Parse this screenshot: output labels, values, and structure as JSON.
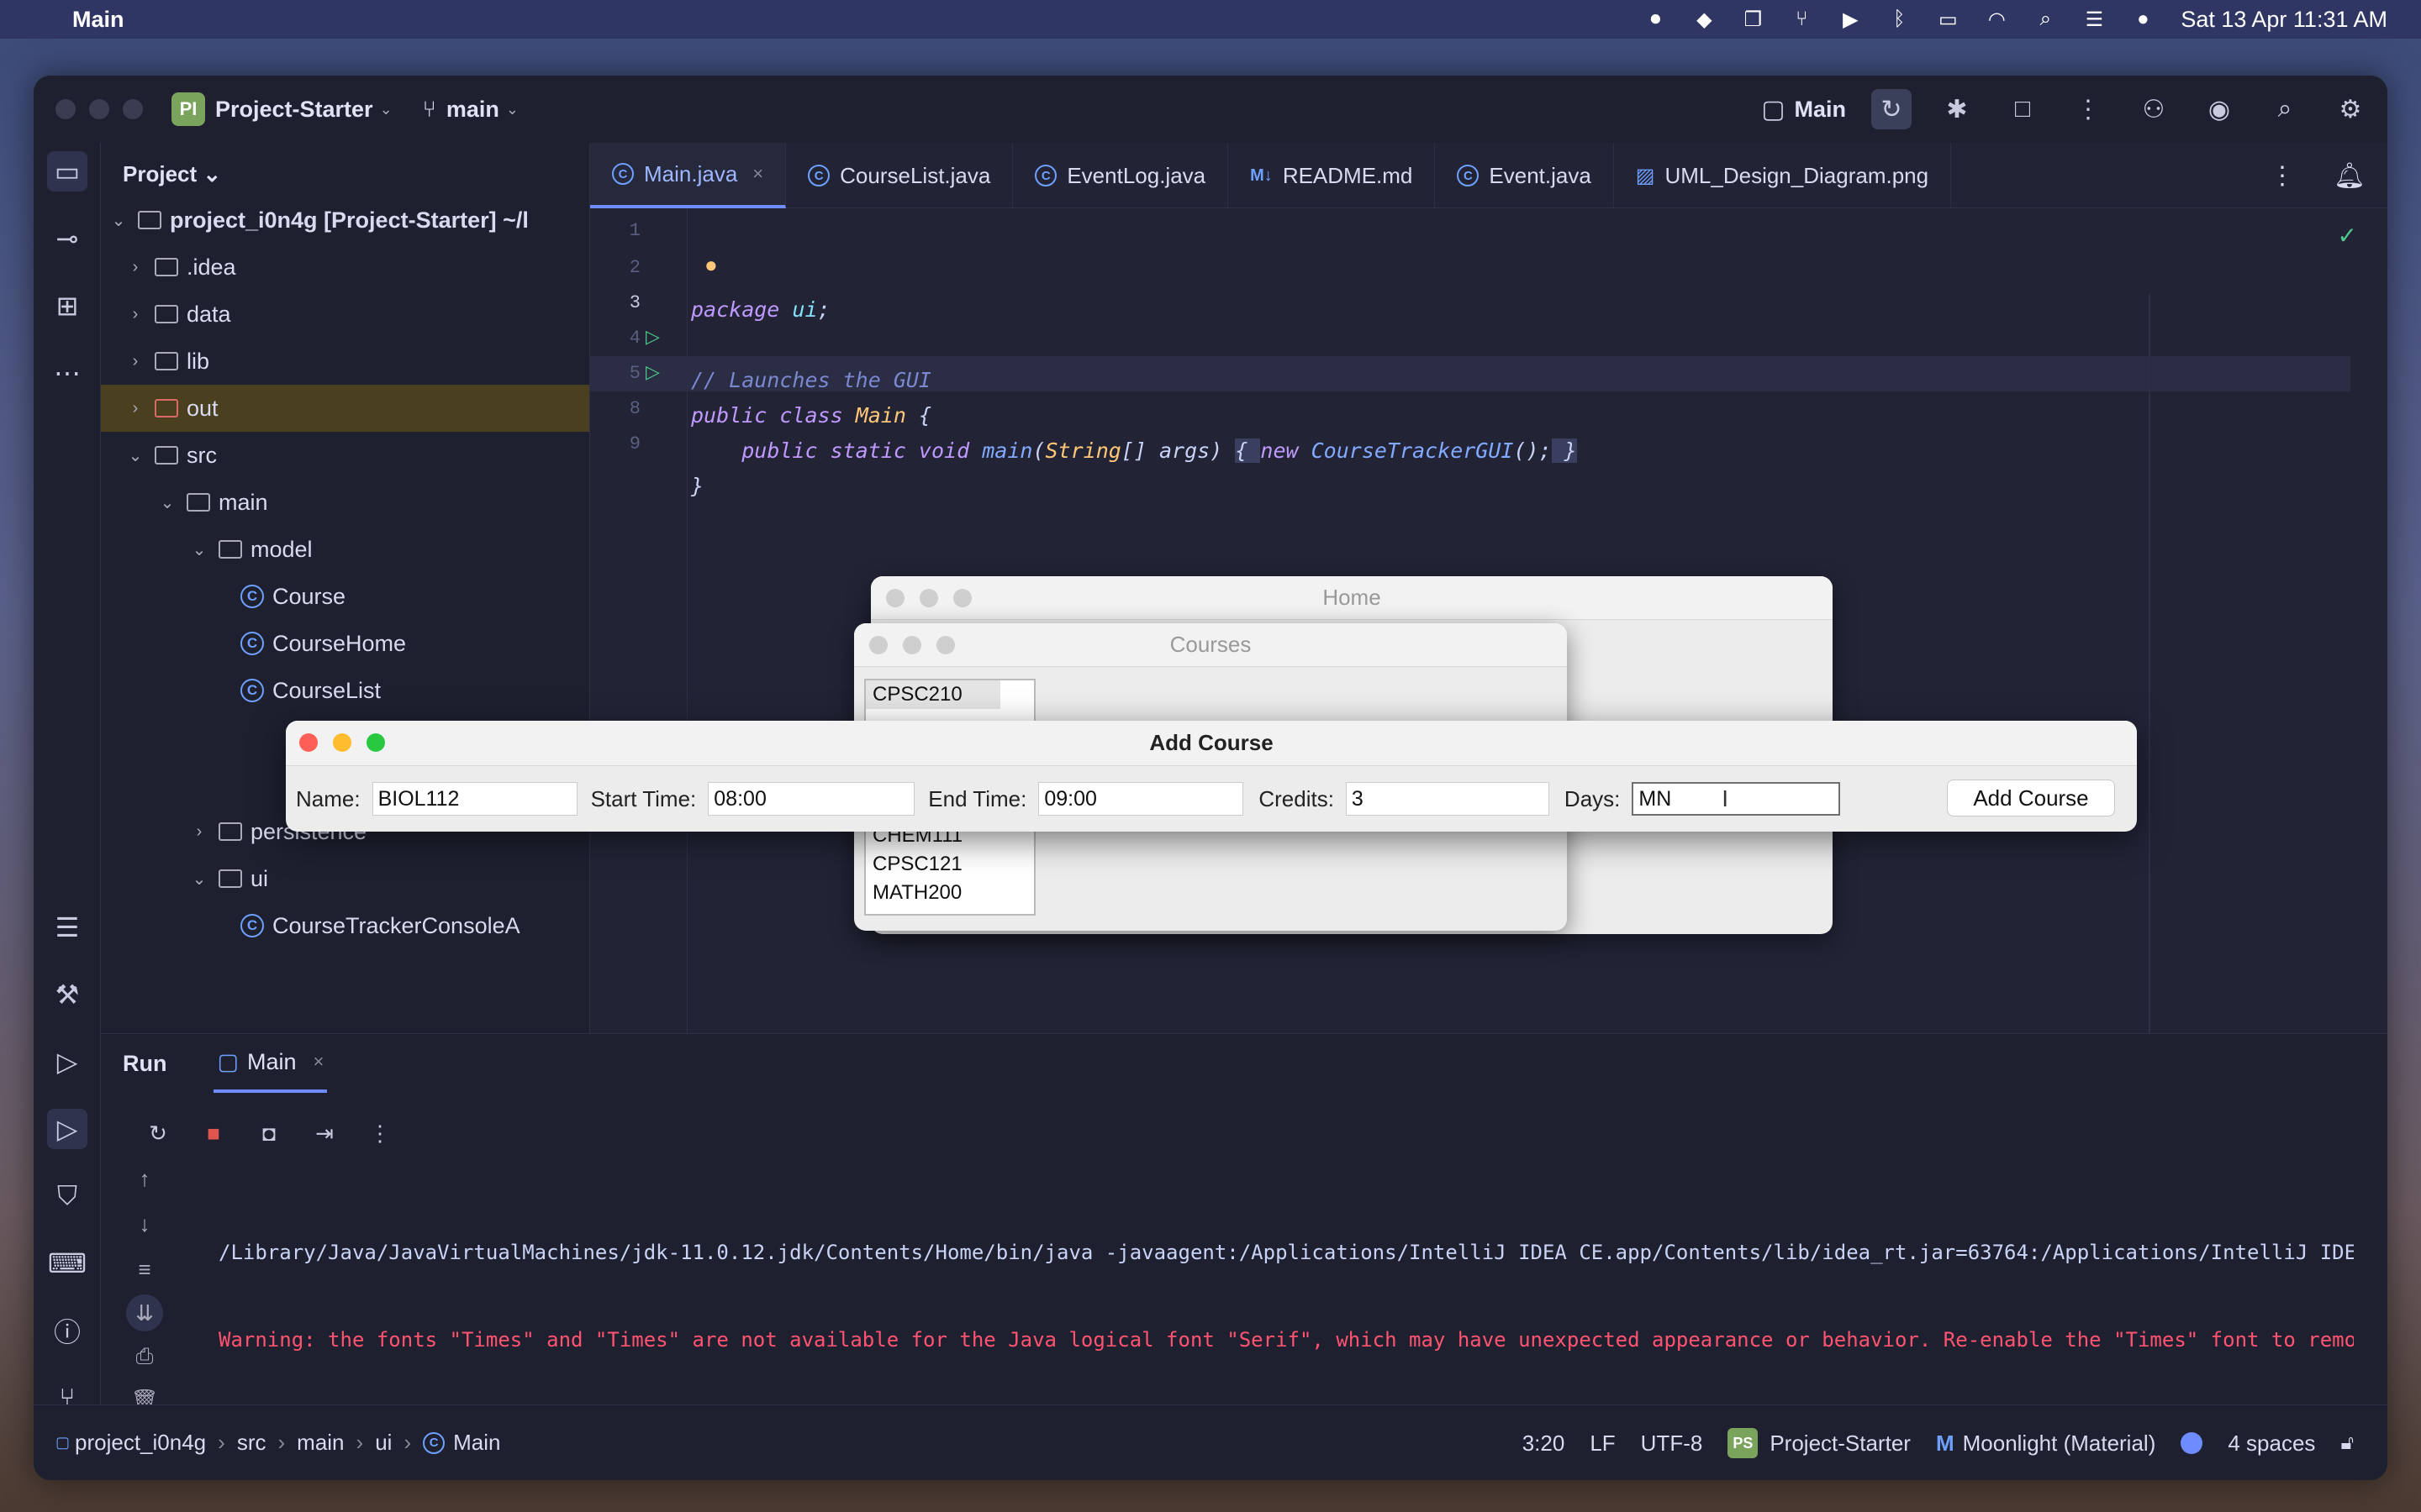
{
  "menubar": {
    "app_name": "Main",
    "datetime": "Sat 13 Apr  11:31 AM"
  },
  "titlebar": {
    "project_badge": "PI",
    "project_name": "Project-Starter",
    "branch": "main",
    "run_config": "Main"
  },
  "project_panel": {
    "title": "Project",
    "tree": [
      {
        "label": "project_i0n4g [Project-Starter] ~/l"
      },
      {
        "label": ".idea"
      },
      {
        "label": "data"
      },
      {
        "label": "lib"
      },
      {
        "label": "out"
      },
      {
        "label": "src"
      },
      {
        "label": "main"
      },
      {
        "label": "model"
      },
      {
        "label": "Course"
      },
      {
        "label": "CourseHome"
      },
      {
        "label": "CourseList"
      },
      {
        "label": "persistence"
      },
      {
        "label": "ui"
      },
      {
        "label": "CourseTrackerConsoleA"
      }
    ]
  },
  "editor": {
    "tabs": [
      {
        "label": "Main.java",
        "icon": "C"
      },
      {
        "label": "CourseList.java",
        "icon": "C"
      },
      {
        "label": "EventLog.java",
        "icon": "C"
      },
      {
        "label": "README.md",
        "icon": "M↓"
      },
      {
        "label": "Event.java",
        "icon": "C"
      },
      {
        "label": "UML_Design_Diagram.png",
        "icon": "img"
      }
    ],
    "line_numbers": [
      "1",
      "2",
      "3",
      "4",
      "5",
      "8",
      "9"
    ],
    "code": {
      "l1_kw": "package",
      "l1_pk": "ui",
      "l3_comment": "// Launches the GUI",
      "l4_kw": "public class",
      "l4_cn": "Main",
      "l5_kw": "public static void",
      "l5_fn": "main",
      "l5_type": "String",
      "l5_args": "args",
      "l5_new": "new",
      "l5_call": "CourseTrackerGUI"
    }
  },
  "home_window": {
    "title": "Home"
  },
  "courses_window": {
    "title": "Courses",
    "top_list": [
      "CPSC210"
    ],
    "bottom_list": [
      "CHEM111",
      "CPSC121",
      "MATH200"
    ]
  },
  "add_course": {
    "title": "Add Course",
    "name_label": "Name:",
    "name_value": "BIOL112",
    "start_label": "Start Time:",
    "start_value": "08:00",
    "end_label": "End Time:",
    "end_value": "09:00",
    "credits_label": "Credits:",
    "credits_value": "3",
    "days_label": "Days:",
    "days_value": "MN",
    "button": "Add Course"
  },
  "run_panel": {
    "run_label": "Run",
    "tab_label": "Main",
    "console": [
      {
        "text": "/Library/Java/JavaVirtualMachines/jdk-11.0.12.jdk/Contents/Home/bin/java -javaagent:/Applications/IntelliJ IDEA CE.app/Contents/lib/idea_rt.jar=63764:/Applications/IntelliJ IDE",
        "color": "#c8d3f5"
      },
      {
        "text": "Warning: the fonts \"Times\" and \"Times\" are not available for the Java logical font \"Serif\", which may have unexpected appearance or behavior. Re-enable the \"Times\" font to remo",
        "color": "#ff5370"
      }
    ]
  },
  "statusbar": {
    "breadcrumb": [
      "project_i0n4g",
      "src",
      "main",
      "ui",
      "Main"
    ],
    "position": "3:20",
    "line_sep": "LF",
    "encoding": "UTF-8",
    "ps_badge": "PS",
    "project": "Project-Starter",
    "theme": "Moonlight (Material)",
    "indent": "4 spaces"
  }
}
